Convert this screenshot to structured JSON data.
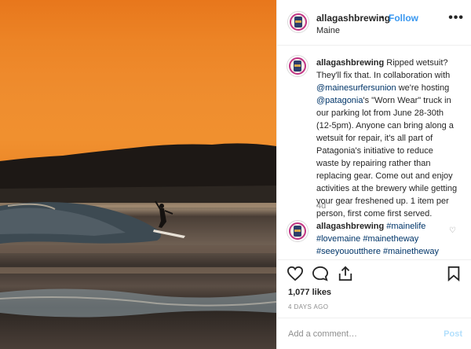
{
  "post": {
    "username": "allagashbrewing",
    "separator": "•",
    "follow_label": "Follow",
    "location": "Maine",
    "more_label": "•••"
  },
  "caption": {
    "username": "allagashbrewing",
    "text_1": " Ripped wetsuit? They'll fix that. In collaboration with ",
    "mention_1": "@mainesurfersunion",
    "text_2": " we're hosting ",
    "mention_2": "@patagonia",
    "text_3": "'s \"Worn Wear\" truck in our parking lot from June 28-30th (12-5pm). Anyone can bring along a wetsuit for repair, it's all part of Patagonia's initiative to reduce waste by repairing rather than replacing gear. Come out and enjoy activities at the brewery while getting your gear freshened up. 1 item per person, first come first served.",
    "time": "4d"
  },
  "comment": {
    "username": "allagashbrewing",
    "tags": "#mainelife #lovemaine #maineheway #seeyououtthere #maineheway",
    "tag_1": "#mainelife",
    "tag_2": "#lovemaine",
    "tag_3": "#mainetheway",
    "tag_4": "#seeyououtthere",
    "tag_5": "#mainetheway"
  },
  "stats": {
    "likes": "1,077 likes",
    "posted": "4 DAYS AGO"
  },
  "add_comment": {
    "placeholder": "Add a comment…",
    "post_label": "Post"
  },
  "icons": {
    "like": "heart-icon",
    "comment": "comment-icon",
    "share": "share-icon",
    "save": "bookmark-icon",
    "more": "more-icon"
  }
}
